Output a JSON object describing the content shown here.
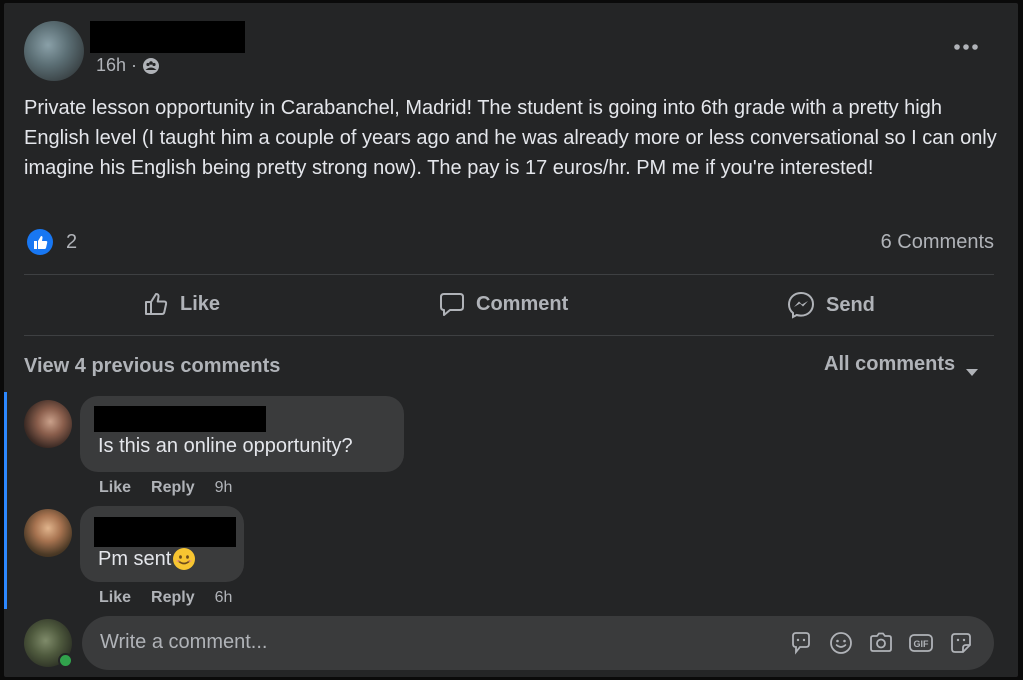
{
  "post": {
    "time": "16h",
    "separator": "·",
    "text": "Private lesson opportunity in Carabanchel, Madrid! The student is going into 6th grade with a pretty high English level (I taught him a couple of years ago and he was already more or less conversational so I can only imagine his English being pretty strong now). The pay is 17 euros/hr. PM me if you're interested!",
    "reaction_count": "2",
    "comments_count": "6 Comments"
  },
  "actions": {
    "like": "Like",
    "comment": "Comment",
    "send": "Send"
  },
  "comments_section": {
    "view_previous": "View 4 previous comments",
    "filter": "All comments"
  },
  "comments": [
    {
      "text": "Is this an online opportunity?",
      "like": "Like",
      "reply": "Reply",
      "time": "9h"
    },
    {
      "text": "Pm sent",
      "like": "Like",
      "reply": "Reply",
      "time": "6h"
    }
  ],
  "composer": {
    "placeholder": "Write a comment..."
  },
  "colors": {
    "card_bg": "#242526",
    "bubble_bg": "#3a3b3c",
    "like_blue": "#1877f2",
    "thread_line": "#2d88ff",
    "online_green": "#31a24c"
  }
}
